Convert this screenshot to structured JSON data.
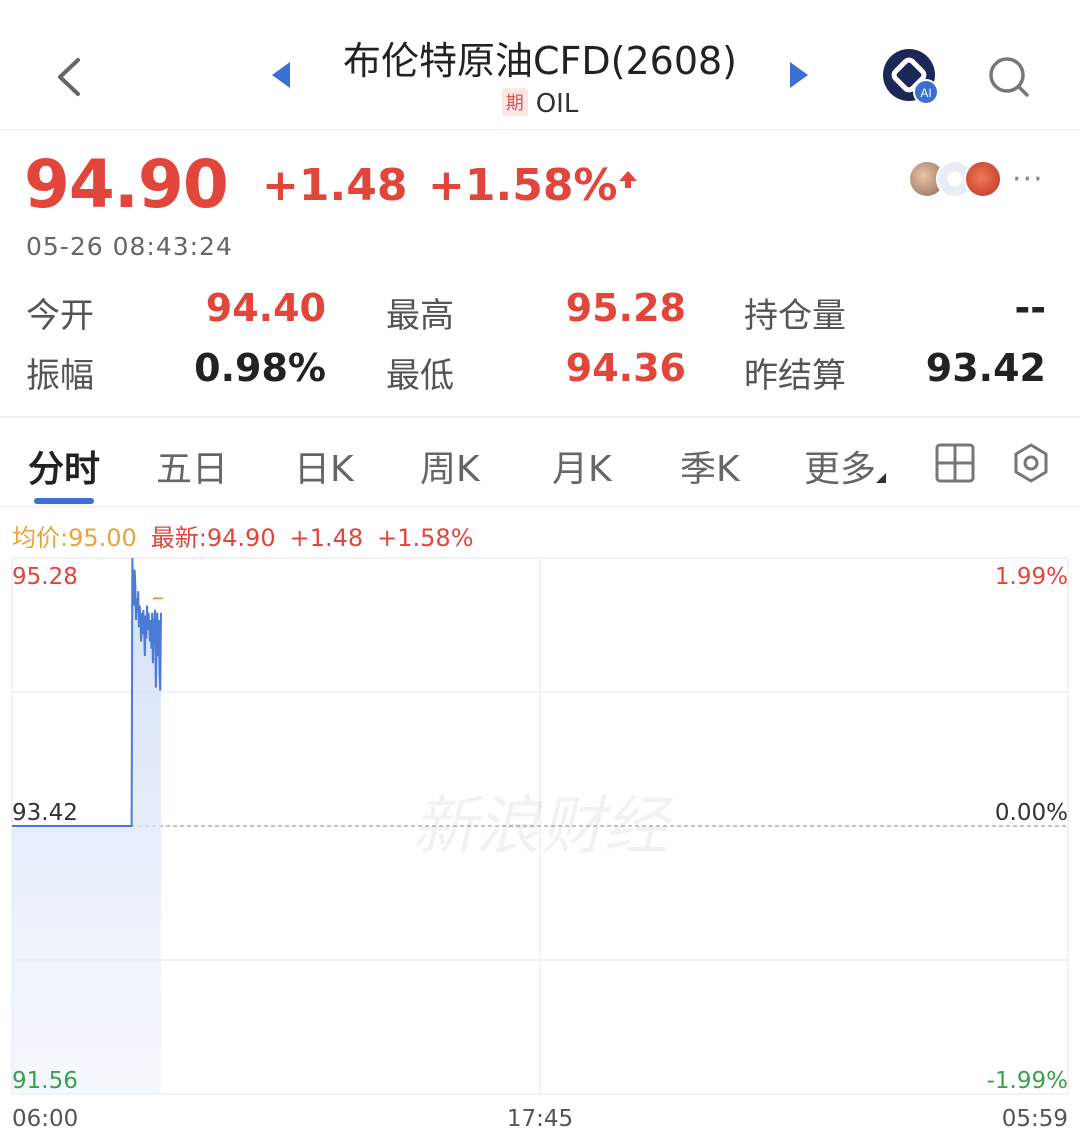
{
  "header": {
    "title": "布伦特原油CFD(2608)",
    "badge": "期",
    "subtitle": "OIL",
    "ai_badge": "AI"
  },
  "quote": {
    "price": "94.90",
    "change": "+1.48",
    "change_pct": "+1.58%",
    "timestamp": "05-26 08:43:24",
    "more": "···"
  },
  "stats": {
    "open_label": "今开",
    "open_value": "94.40",
    "high_label": "最高",
    "high_value": "95.28",
    "oi_label": "持仓量",
    "oi_value": "--",
    "amplitude_label": "振幅",
    "amplitude_value": "0.98%",
    "low_label": "最低",
    "low_value": "94.36",
    "prev_settle_label": "昨结算",
    "prev_settle_value": "93.42"
  },
  "tabs": [
    {
      "label": "分时",
      "active": true
    },
    {
      "label": "五日",
      "active": false
    },
    {
      "label": "日K",
      "active": false
    },
    {
      "label": "周K",
      "active": false
    },
    {
      "label": "月K",
      "active": false
    },
    {
      "label": "季K",
      "active": false
    },
    {
      "label": "更多",
      "active": false
    }
  ],
  "chart_info": {
    "avg": "均价:95.00",
    "latest": "最新:94.90",
    "change": "+1.48",
    "change_pct": "+1.58%"
  },
  "chart_data": {
    "type": "line",
    "watermark": "新浪财经",
    "y_left_labels": [
      "95.28",
      "93.42",
      "91.56"
    ],
    "y_right_labels": [
      "1.99%",
      "0.00%",
      "-1.99%"
    ],
    "x_labels": [
      "06:00",
      "17:45",
      "05:59"
    ],
    "ylim": [
      91.56,
      95.28
    ],
    "baseline": 93.42,
    "total_minutes": 1439,
    "series": [
      {
        "values": [
          93.42,
          93.42,
          93.42,
          93.42,
          93.42,
          93.42,
          93.42,
          93.42,
          93.42,
          93.42,
          93.42,
          93.42,
          93.42,
          93.42,
          93.42,
          93.42,
          93.42,
          93.42,
          93.42,
          93.42,
          93.42,
          93.42,
          93.42,
          93.42,
          93.42,
          93.42,
          93.42,
          93.42,
          93.42,
          93.42,
          93.42,
          93.42,
          93.42,
          93.42,
          93.42,
          93.42,
          93.42,
          93.42,
          93.42,
          93.42,
          93.42,
          93.42,
          93.42,
          93.42,
          93.42,
          93.42,
          93.42,
          93.42,
          93.42,
          93.42,
          93.42,
          93.42,
          93.42,
          93.42,
          93.42,
          93.42,
          93.42,
          93.42,
          93.42,
          93.42,
          93.42,
          93.42,
          93.42,
          93.42,
          93.42,
          93.42,
          93.42,
          93.42,
          93.42,
          93.42,
          93.42,
          93.42,
          93.42,
          93.42,
          93.42,
          93.42,
          93.42,
          93.42,
          93.42,
          93.42,
          93.42,
          93.42,
          93.42,
          93.42,
          93.42,
          93.42,
          93.42,
          93.42,
          93.42,
          93.42,
          93.42,
          93.42,
          93.42,
          93.42,
          93.42,
          93.42,
          93.42,
          93.42,
          93.42,
          93.42,
          93.42,
          93.42,
          93.42,
          93.42,
          93.42,
          93.42,
          93.42,
          93.42,
          93.42,
          93.42,
          93.42,
          93.42,
          93.42,
          93.42,
          93.42,
          93.42,
          93.42,
          93.42,
          93.42,
          93.42,
          93.42,
          93.42,
          93.42,
          93.42,
          93.42,
          93.42,
          93.42,
          93.42,
          93.42,
          93.42,
          93.42,
          93.42,
          93.42,
          93.42,
          93.42,
          93.42,
          93.42,
          93.42,
          93.42,
          93.42,
          93.42,
          93.42,
          93.42,
          93.42,
          93.42,
          93.42,
          93.42,
          93.42,
          93.42,
          93.42,
          93.42,
          93.42,
          93.42,
          93.42,
          93.42,
          93.42,
          93.42,
          93.42,
          93.42,
          93.42,
          93.42,
          93.42,
          93.42,
          93.42,
          95.28,
          95.05,
          94.95,
          95.2,
          95.1,
          94.85,
          95.0,
          94.9,
          95.05,
          94.8,
          94.95,
          94.85,
          94.7,
          94.9,
          94.75,
          94.92,
          94.8,
          94.6,
          94.88,
          94.72,
          94.95,
          94.78,
          94.9,
          94.82,
          94.7,
          94.85,
          94.65,
          94.9,
          94.55,
          94.75,
          94.85,
          94.92,
          94.38,
          94.7,
          94.9,
          94.6,
          94.85,
          94.5,
          94.36,
          94.9
        ]
      }
    ],
    "avg_line": 95.0
  },
  "colors": {
    "up": "#e2463b",
    "down": "#3aa14a",
    "accent": "#3b6fd6",
    "avg": "#e8a33c",
    "line": "#4a7bd6"
  }
}
